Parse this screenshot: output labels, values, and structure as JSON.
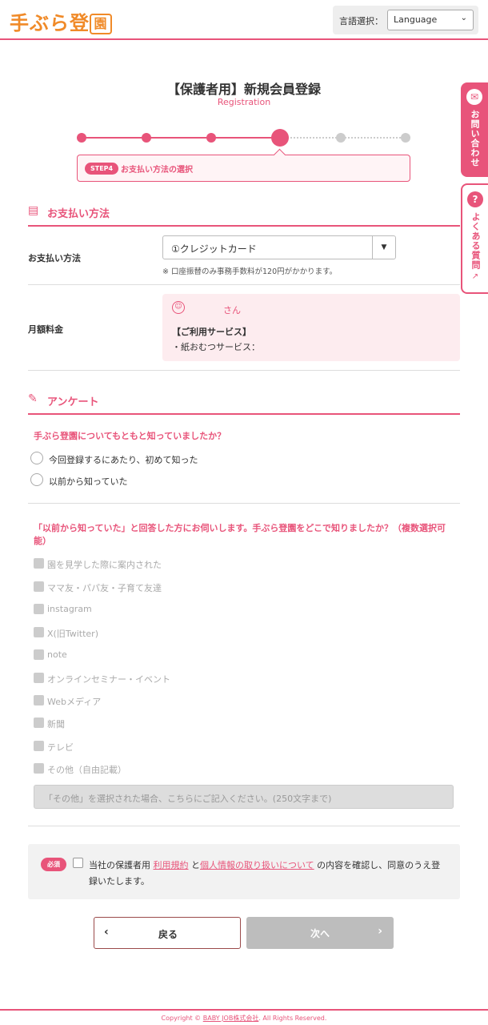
{
  "header": {
    "logo_text": "手ぶら登",
    "logo_mark": "園",
    "lang_label": "言語選択：",
    "lang_value": "Language"
  },
  "side": {
    "contact": "お問い合わせ",
    "faq": "よくある質問"
  },
  "page": {
    "title": "【保護者用】新規会員登録",
    "subtitle": "Registration"
  },
  "steps": {
    "total": 6,
    "current": 4,
    "badge": "STEP4",
    "text": "お支払い方法の選択"
  },
  "payment": {
    "section_title": "お支払い方法",
    "label": "お支払い方法",
    "selected": "①クレジットカード",
    "note": "※ 口座振替のみ事務手数料が120円がかかります。",
    "fee_label": "月額料金",
    "san": "さん",
    "service_title": "【ご利用サービス】",
    "service_item": "・紙おむつサービス："
  },
  "survey": {
    "section_title": "アンケート",
    "q1": "手ぶら登園についてもともと知っていましたか？",
    "q1_options": [
      "今回登録するにあたり、初めて知った",
      "以前から知っていた"
    ],
    "q2": "「以前から知っていた」と回答した方にお伺いします。手ぶら登園をどこで知りましたか？（複数選択可能）",
    "q2_options": [
      "園を見学した際に案内された",
      "ママ友・パパ友・子育て友達",
      "instagram",
      "X(旧Twitter)",
      "note",
      "オンラインセミナー・イベント",
      "Webメディア",
      "新聞",
      "テレビ",
      "その他（自由記載）"
    ],
    "other_placeholder": "「その他」を選択された場合、こちらにご記入ください。(250文字まで)"
  },
  "agree": {
    "badge": "必須",
    "pre": "当社の保護者用",
    "link1": "利用規約",
    "mid": "と",
    "link2": "個人情報の取り扱いについて",
    "post": "の内容を確認し、同意のうえ登録いたします。"
  },
  "buttons": {
    "back": "戻る",
    "next": "次へ"
  },
  "footer": {
    "pre": "Copyright © ",
    "company": "BABY JOB株式会社",
    "post": ". All Rights Reserved."
  }
}
